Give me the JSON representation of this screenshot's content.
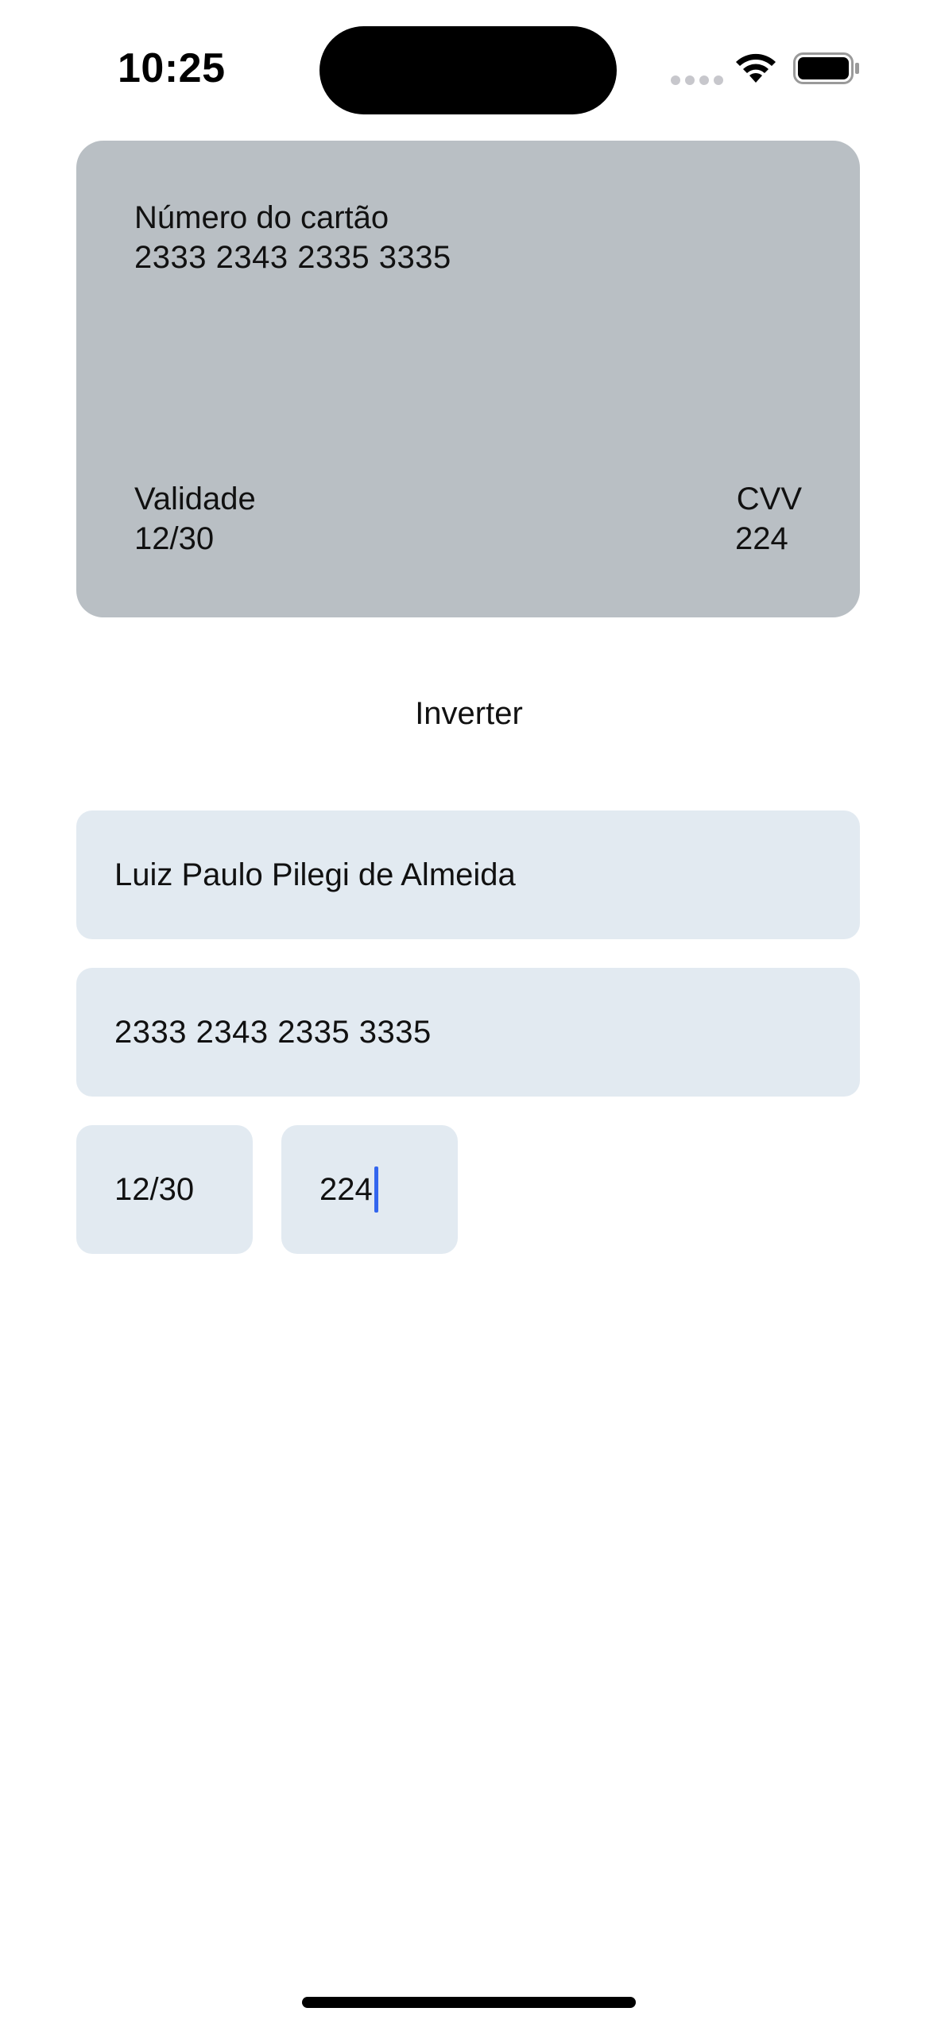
{
  "status_bar": {
    "time": "10:25"
  },
  "card_preview": {
    "number_label": "Número do cartão",
    "number_value": "2333 2343 2335 3335",
    "validity_label": "Validade",
    "validity_value": "12/30",
    "cvv_label": "CVV",
    "cvv_value": "224",
    "background_color": "#b9bfc4"
  },
  "actions": {
    "invert_label": "Inverter"
  },
  "form": {
    "name_value": "Luiz Paulo Pilegi de Almeida",
    "number_value": "2333 2343 2335 3335",
    "expiry_value": "12/30",
    "cvv_value": "224",
    "field_background_color": "#e2eaf1",
    "caret_color": "#3366ee"
  },
  "icons": {
    "signal": "cellular-signal-icon",
    "wifi": "wifi-icon",
    "battery": "battery-icon"
  }
}
